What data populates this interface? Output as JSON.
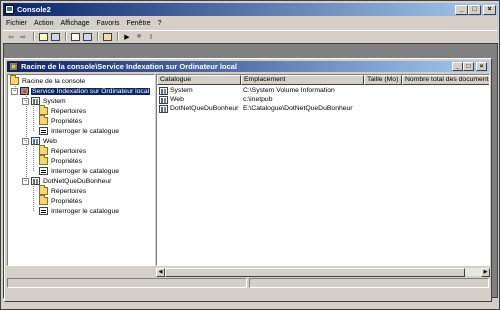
{
  "app": {
    "title": "Console2"
  },
  "menu": [
    "Fichier",
    "Action",
    "Affichage",
    "Favoris",
    "Fenêtre",
    "?"
  ],
  "child_window": {
    "title": "Racine de la console\\Service Indexation sur Ordinateur local"
  },
  "tree": {
    "root": "Racine de la console",
    "service": "Service Indexation sur Ordinateur local",
    "catalogs": [
      {
        "name": "System",
        "children": [
          "Répertoires",
          "Propriétés",
          "Interroger le catalogue"
        ]
      },
      {
        "name": "Web",
        "children": [
          "Répertoires",
          "Propriétés",
          "Interroger le catalogue"
        ]
      },
      {
        "name": "DotNetQueDuBonheur",
        "children": [
          "Répertoires",
          "Propriétés",
          "Interroger le catalogue"
        ]
      }
    ]
  },
  "list": {
    "columns": [
      "Catalogue",
      "Emplacement",
      "Taille (Mo)",
      "Nombre total des documents"
    ],
    "rows": [
      {
        "catalogue": "System",
        "emplacement": "C:\\System Volume Information",
        "taille": "",
        "total": ""
      },
      {
        "catalogue": "Web",
        "emplacement": "c:\\inetpub",
        "taille": "",
        "total": ""
      },
      {
        "catalogue": "DotNetQueDuBonheur",
        "emplacement": "E:\\Catalogue\\DotNetQueDuBonheur",
        "taille": "",
        "total": ""
      }
    ]
  },
  "icons": {
    "toolbar": [
      "back-arrow-icon",
      "forward-arrow-icon",
      "up-folder-icon",
      "show-tree-icon",
      "properties-icon",
      "export-list-icon",
      "help-icon",
      "play-icon",
      "stop-icon",
      "pause-icon"
    ]
  },
  "colors": {
    "titlebar_start": "#0a246a",
    "titlebar_end": "#a6caf0",
    "face": "#d4d0c8"
  }
}
